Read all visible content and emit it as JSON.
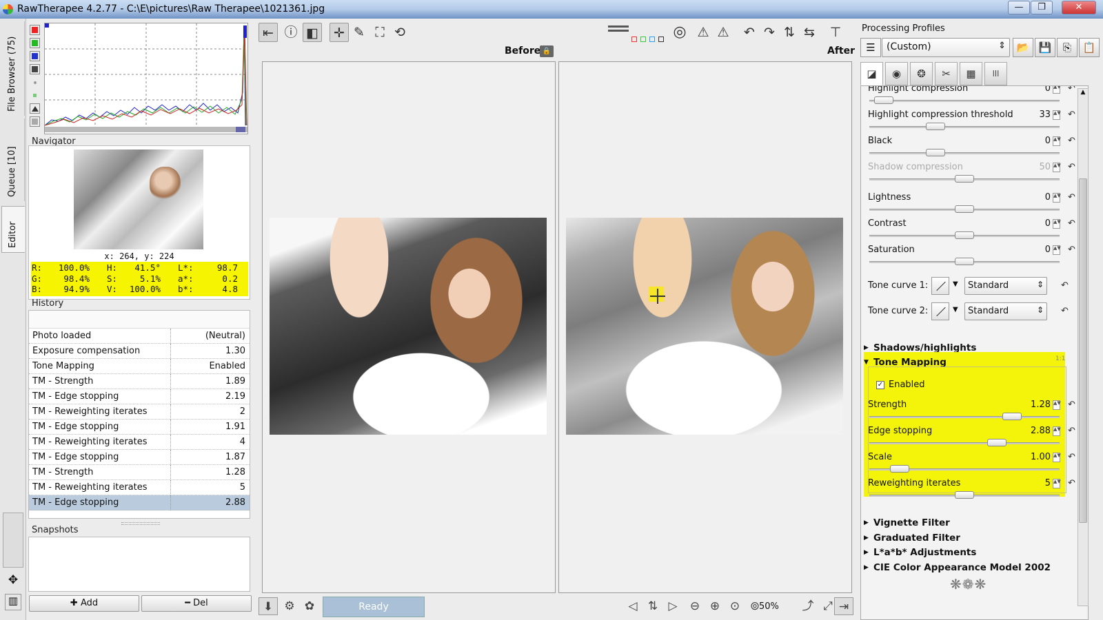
{
  "window": {
    "title": "RawTherapee 4.2.77 - C:\\E\\pictures\\Raw Therapee\\1021361.jpg",
    "min_glyph": "—",
    "max_glyph": "❐",
    "close_glyph": "✕"
  },
  "left_tabs": {
    "file_browser": "File Browser (75)",
    "queue": "Queue [10]",
    "editor": "Editor"
  },
  "navigator": {
    "label": "Navigator",
    "coords": "x: 264, y: 224",
    "rows": [
      {
        "a": "R:",
        "av": "100.0%",
        "b": "H:",
        "bv": "41.5°",
        "c": "L*:",
        "cv": "98.7"
      },
      {
        "a": "G:",
        "av": "98.4%",
        "b": "S:",
        "bv": "5.1%",
        "c": "a*:",
        "cv": "0.2"
      },
      {
        "a": "B:",
        "av": "94.9%",
        "b": "V:",
        "bv": "100.0%",
        "c": "b*:",
        "cv": "4.8"
      }
    ]
  },
  "history": {
    "label": "History",
    "items": [
      {
        "name": "Photo loaded",
        "value": "(Neutral)"
      },
      {
        "name": "Exposure compensation",
        "value": "1.30"
      },
      {
        "name": "Tone Mapping",
        "value": "Enabled"
      },
      {
        "name": "TM - Strength",
        "value": "1.89"
      },
      {
        "name": "TM - Edge stopping",
        "value": "2.19"
      },
      {
        "name": "TM - Reweighting iterates",
        "value": "2"
      },
      {
        "name": "TM - Edge stopping",
        "value": "1.91"
      },
      {
        "name": "TM - Reweighting iterates",
        "value": "4"
      },
      {
        "name": "TM - Edge stopping",
        "value": "1.87"
      },
      {
        "name": "TM - Strength",
        "value": "1.28"
      },
      {
        "name": "TM - Reweighting iterates",
        "value": "5"
      },
      {
        "name": "TM - Edge stopping",
        "value": "2.88"
      }
    ]
  },
  "snapshots": {
    "label": "Snapshots",
    "add": "Add",
    "del": "Del",
    "add_glyph": "✚",
    "del_glyph": "━"
  },
  "viewer": {
    "before": "Before",
    "after": "After",
    "status": "Ready",
    "zoom": "50%",
    "lock_glyph": "🔒"
  },
  "toolbar_icons": {
    "info": "ⓘ",
    "pointer": "✛",
    "picker": "✎",
    "crop": "⛶",
    "straighten": "⟲",
    "warn1": "⚠",
    "warn2": "⚠",
    "rot_left": "↶",
    "rot_right": "↷",
    "flip_h": "⇅",
    "flip_v": "⇆",
    "prev": "◁",
    "sync": "⇅",
    "next": "▷",
    "zoom_out": "⊖",
    "zoom_in": "⊕",
    "zoom_fit": "⊙",
    "zoom_100": "⊚",
    "detail": "⤴",
    "fullscreen": "⤢"
  },
  "profiles": {
    "label": "Processing Profiles",
    "selected": "(Custom)",
    "arrow": "⇕"
  },
  "exposure_sliders": [
    {
      "label": "Highlight compression",
      "value": "0",
      "fraction": 0.03
    },
    {
      "label": "Highlight compression threshold",
      "value": "33",
      "fraction": 0.33
    },
    {
      "label": "Black",
      "value": "0",
      "fraction": 0.33
    },
    {
      "label": "Shadow compression",
      "value": "50",
      "fraction": 0.5,
      "disabled": true
    },
    {
      "label": "Lightness",
      "value": "0",
      "fraction": 0.5
    },
    {
      "label": "Contrast",
      "value": "0",
      "fraction": 0.5
    },
    {
      "label": "Saturation",
      "value": "0",
      "fraction": 0.5
    }
  ],
  "tone_curves": [
    {
      "label": "Tone curve 1:",
      "mode": "Standard"
    },
    {
      "label": "Tone curve 2:",
      "mode": "Standard"
    }
  ],
  "sections": {
    "shadows_highlights": "Shadows/highlights",
    "tone_mapping": "Tone Mapping",
    "vignette": "Vignette Filter",
    "graduated": "Graduated Filter",
    "lab": "L*a*b* Adjustments",
    "ciecam": "CIE Color Appearance Model 2002"
  },
  "tone_mapping": {
    "enabled_label": "Enabled",
    "enabled": true,
    "sliders": [
      {
        "label": "Strength",
        "value": "1.28",
        "fraction": 0.78
      },
      {
        "label": "Edge stopping",
        "value": "2.88",
        "fraction": 0.69
      },
      {
        "label": "Scale",
        "value": "1.00",
        "fraction": 0.12
      },
      {
        "label": "Reweighting iterates",
        "value": "5",
        "fraction": 0.5
      }
    ]
  },
  "colors": {
    "highlight": "#f4f40a",
    "selection": "#b9cbdd"
  }
}
